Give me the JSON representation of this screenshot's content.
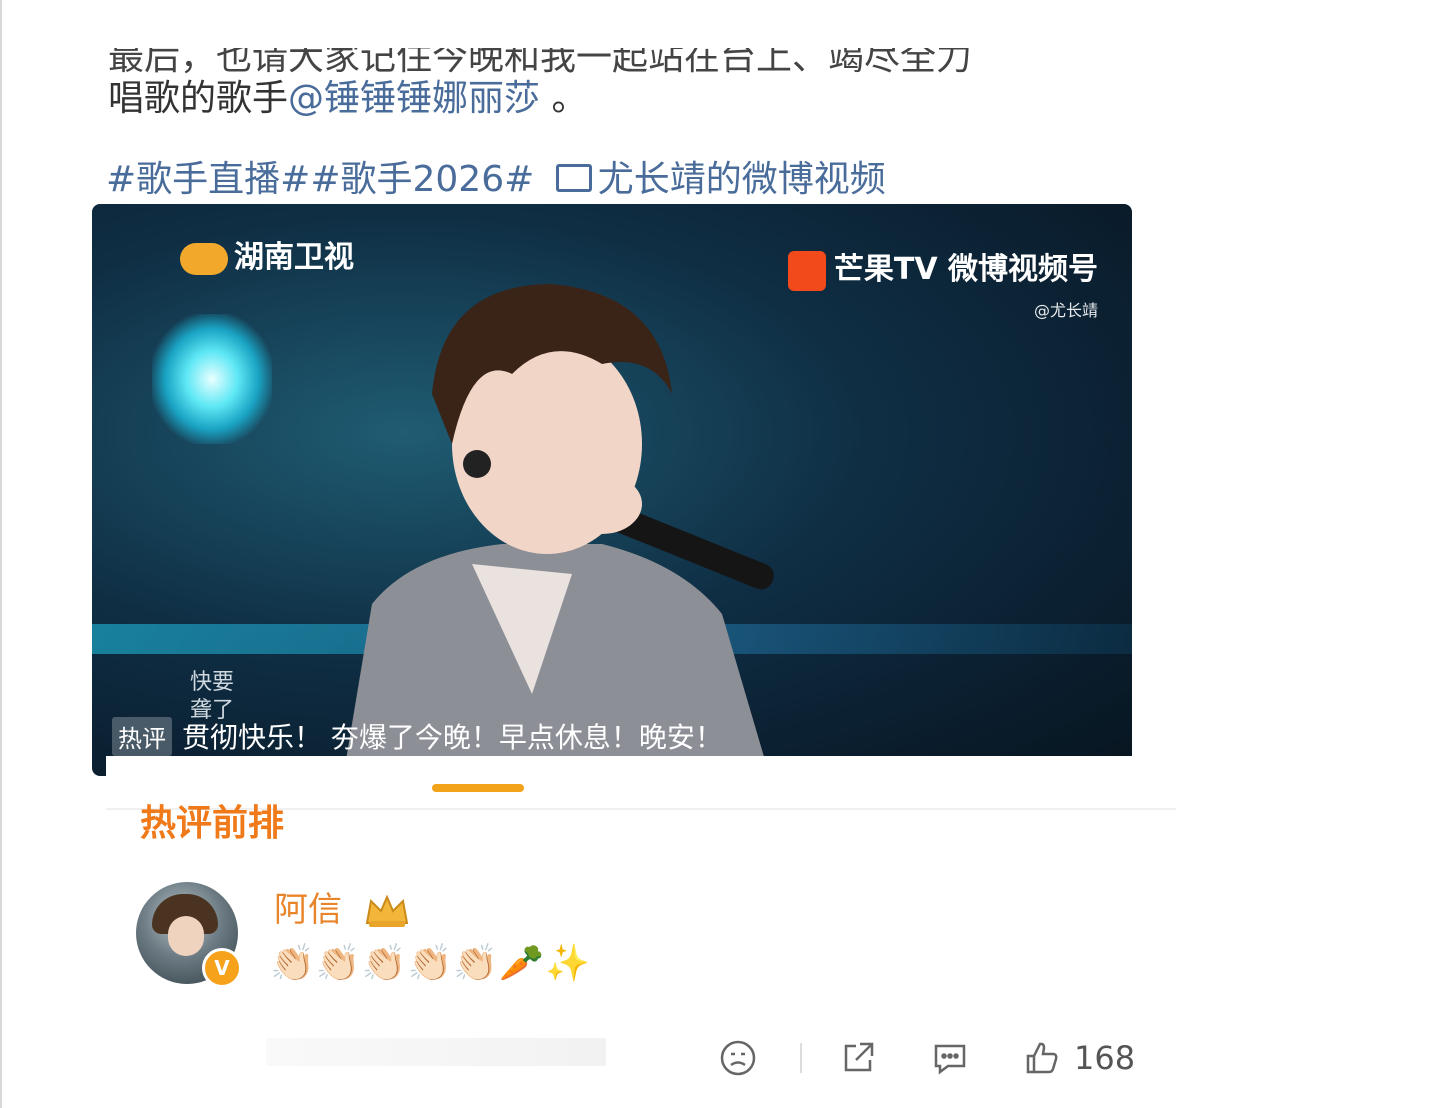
{
  "post": {
    "text_cut": "最后，也请大家记住今晚和我一起站在台上、竭尽全力",
    "text_line2_prefix": "唱歌的歌手",
    "mention": "@锤锤锤娜丽莎",
    "text_line2_suffix": " 。",
    "hashtags": "#歌手直播##歌手2026#",
    "video_link": "尤长靖的微博视频"
  },
  "video": {
    "channel": "湖南卫视",
    "brand": "芒果TV 微博视频号",
    "brand_handle": "@尤长靖",
    "side_note": "快要聋了",
    "hot_tag": "热评",
    "hot_comment": "贯彻快乐！ 夯爆了今晚！早点休息！晚安！"
  },
  "comments_panel": {
    "section_title": "热评前排",
    "comment": {
      "username": "阿信",
      "text": "👏🏻👏🏻👏🏻👏🏻👏🏻🥕✨",
      "like_count": "168"
    }
  },
  "icons": {
    "frown": "frown-face-icon",
    "share": "share-icon",
    "comment": "comment-bubble-icon",
    "like": "thumbs-up-icon",
    "verified": "verified-v-icon",
    "crown": "crown-badge-icon"
  },
  "colors": {
    "link": "#4a6c9a",
    "accent_orange": "#f07a1a",
    "username": "#e8842a"
  }
}
